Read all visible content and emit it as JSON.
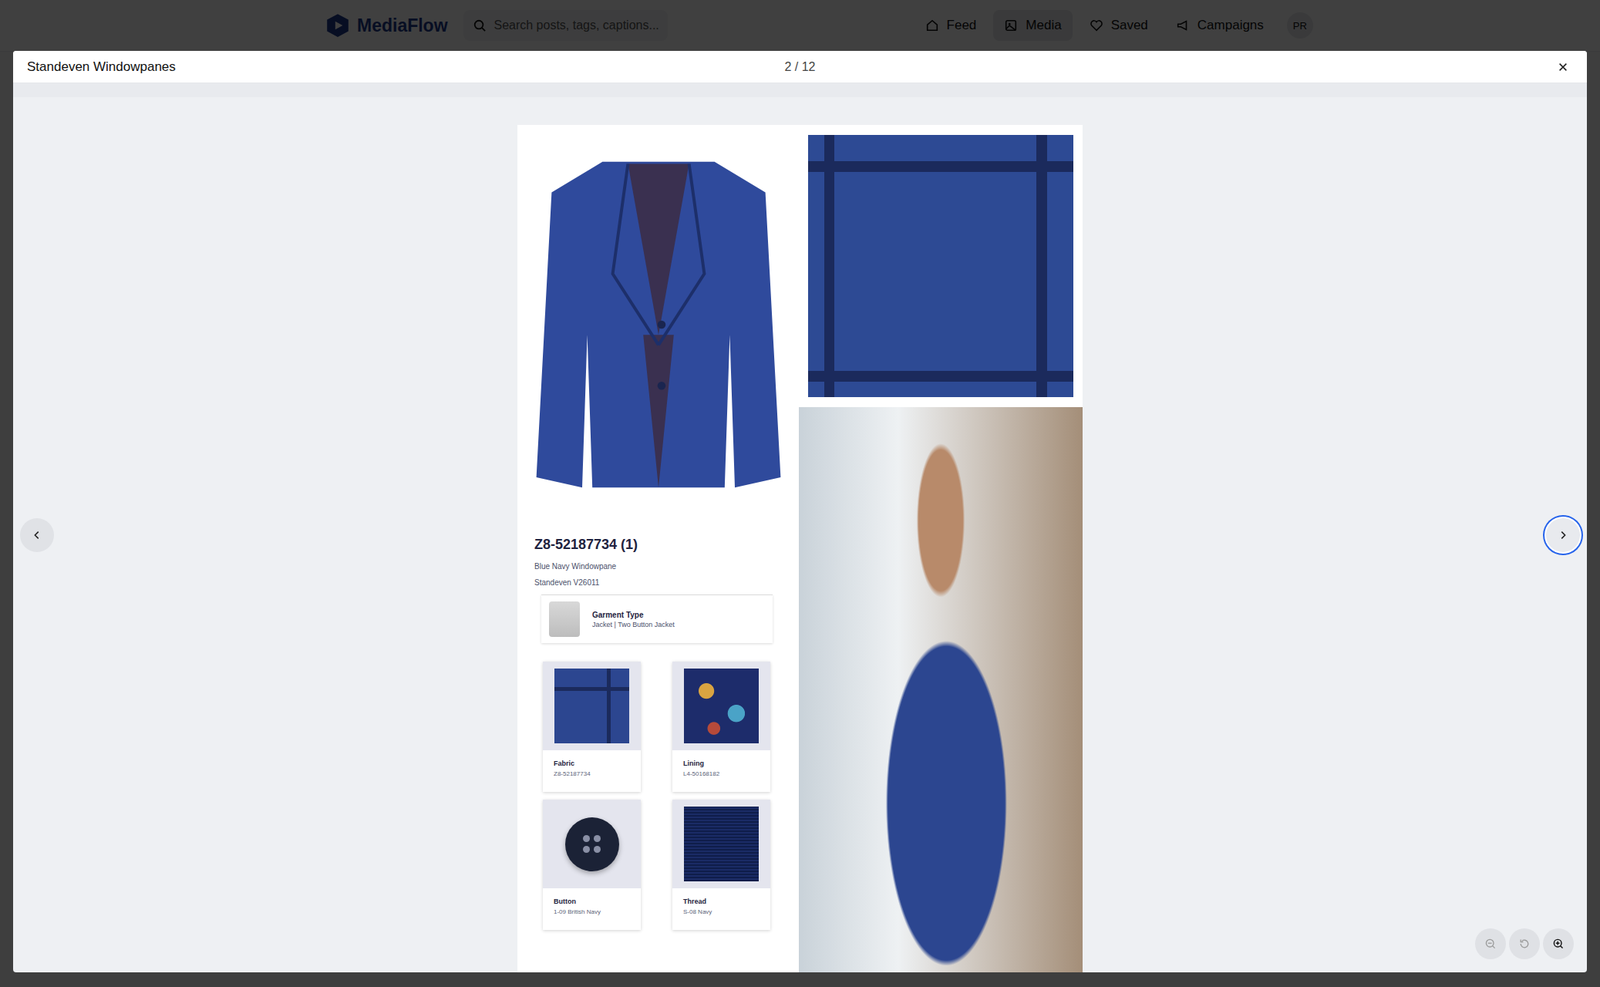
{
  "app": {
    "brand": "MediaFlow",
    "search": {
      "placeholder": "Search posts, tags, captions..."
    },
    "nav": [
      {
        "label": "Feed",
        "icon": "home",
        "selected": false
      },
      {
        "label": "Media",
        "icon": "image",
        "selected": true
      },
      {
        "label": "Saved",
        "icon": "heart",
        "selected": false
      },
      {
        "label": "Campaigns",
        "icon": "megaphone",
        "selected": false
      }
    ],
    "avatar": "PR"
  },
  "viewer": {
    "title": "Standeven Windowpanes",
    "counter": "2 / 12",
    "arrows": [
      {
        "direction": "prev",
        "focused": false
      },
      {
        "direction": "next",
        "focused": true
      }
    ]
  },
  "sheet": {
    "code": "Z8-52187734 (1)",
    "name": "Blue Navy Windowpane",
    "collection": "Standeven V26011",
    "garment": {
      "label": "Garment Type",
      "value": "Jacket | Two Button Jacket"
    },
    "components": [
      {
        "label": "Fabric",
        "code": "Z8-52187734",
        "kind": "fabric"
      },
      {
        "label": "Lining",
        "code": "L4-50168182",
        "kind": "lining"
      },
      {
        "label": "Button",
        "code": "1-09 British Navy",
        "kind": "button"
      },
      {
        "label": "Thread",
        "code": "S-08 Navy",
        "kind": "thread"
      }
    ]
  }
}
